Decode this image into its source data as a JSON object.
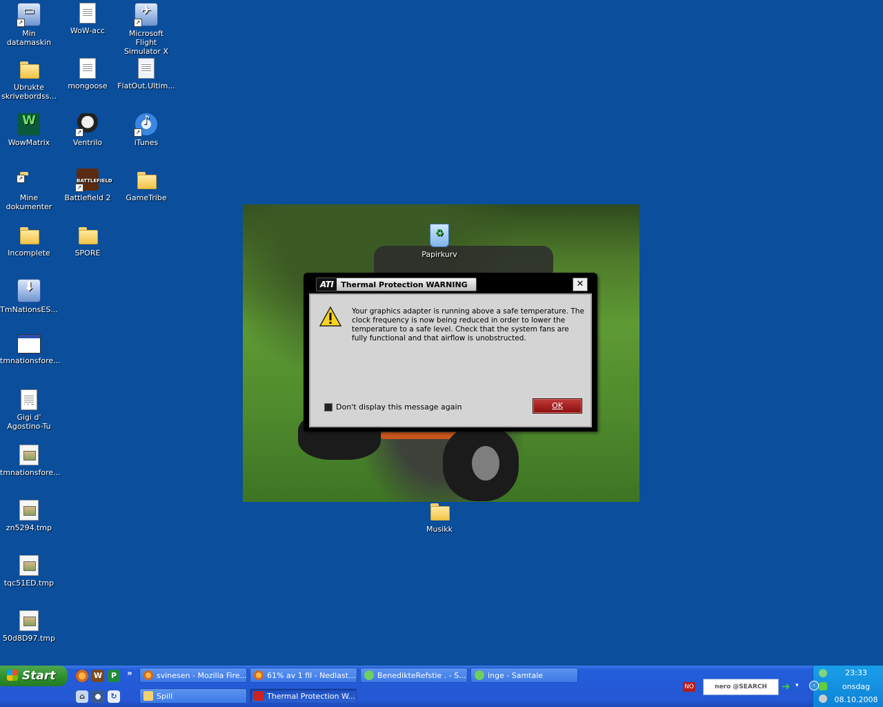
{
  "desktop": {
    "icons": [
      {
        "label": "Min datamaskin",
        "icon": "computer-icon"
      },
      {
        "label": "WoW-acc",
        "icon": "document-icon"
      },
      {
        "label": "Microsoft Flight Simulator X",
        "icon": "airplane-icon"
      },
      {
        "label": "Ubrukte skrivebordss...",
        "icon": "folder-icon"
      },
      {
        "label": "mongoose",
        "icon": "document-icon"
      },
      {
        "label": "FlatOut.Ultim...",
        "icon": "file-icon"
      },
      {
        "label": "WowMatrix",
        "icon": "wowmatrix-icon"
      },
      {
        "label": "Ventrilo",
        "icon": "headset-icon"
      },
      {
        "label": "iTunes",
        "icon": "itunes-icon"
      },
      {
        "label": "Mine dokumenter",
        "icon": "documents-folder-icon"
      },
      {
        "label": "Battlefield 2",
        "icon": "battlefield-icon"
      },
      {
        "label": "GameTribe",
        "icon": "folder-icon"
      },
      {
        "label": "Incomplete",
        "icon": "folder-icon"
      },
      {
        "label": "SPORE",
        "icon": "folder-icon"
      },
      {
        "label": "TmNationsES...",
        "icon": "installer-icon"
      },
      {
        "label": "tmnationsfore...",
        "icon": "window-icon"
      },
      {
        "label": "Gigi d' Agostino-Tu",
        "icon": "mp3-icon"
      },
      {
        "label": "tmnationsfore...",
        "icon": "image-file-icon"
      },
      {
        "label": "zn5294.tmp",
        "icon": "tmp-file-icon"
      },
      {
        "label": "tqc51ED.tmp",
        "icon": "tmp-file-icon"
      },
      {
        "label": "50d8D97.tmp",
        "icon": "tmp-file-icon"
      },
      {
        "label": "Papirkurv",
        "icon": "recycle-bin-icon"
      },
      {
        "label": "Musikk",
        "icon": "folder-icon"
      }
    ]
  },
  "dialog": {
    "logo": "ATI",
    "title": "Thermal Protection WARNING",
    "close": "✕",
    "message": "Your graphics adapter is running above a safe temperature. The clock frequency is now being reduced in order to lower the temperature to a safe level. Check that the system fans are fully functional and that airflow is unobstructed.",
    "checkbox_label": "Don't display this message again",
    "ok": "OK"
  },
  "taskbar": {
    "start": "Start",
    "more": "»",
    "quicklaunch": [
      "firefox-icon",
      "wow-icon",
      "app-icon",
      "home-icon",
      "media-icon",
      "refresh-icon"
    ],
    "tasks_row1": [
      {
        "label": "svinesen - Mozilla Fire...",
        "icon": "firefox-icon"
      },
      {
        "label": "61% av 1 fil - Nedlast...",
        "icon": "firefox-icon"
      },
      {
        "label": "BenedikteRefstie . - S...",
        "icon": "messenger-icon"
      },
      {
        "label": "inge - Samtale",
        "icon": "messenger-icon"
      }
    ],
    "tasks_row2": [
      {
        "label": "Spill",
        "icon": "folder-icon"
      },
      {
        "label": "Thermal Protection W...",
        "icon": "ati-icon"
      }
    ],
    "lang": "NO",
    "nero": "nero @SEARCH",
    "time": "23:33",
    "day": "onsdag",
    "date": "08.10.2008"
  }
}
